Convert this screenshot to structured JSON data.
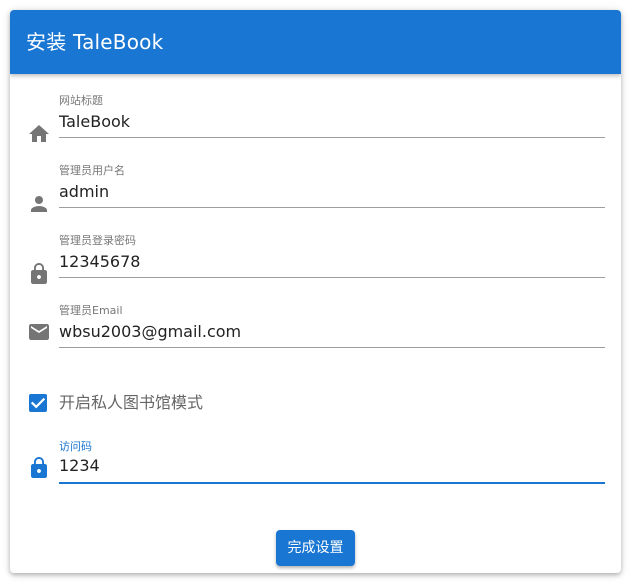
{
  "title": "安装 TaleBook",
  "fields": [
    {
      "label": "网站标题",
      "value": "TaleBook",
      "icon": "home-icon"
    },
    {
      "label": "管理员用户名",
      "value": "admin",
      "icon": "person-icon"
    },
    {
      "label": "管理员登录密码",
      "value": "12345678",
      "icon": "lock-icon"
    },
    {
      "label": "管理员Email",
      "value": "wbsu2003@gmail.com",
      "icon": "email-icon"
    }
  ],
  "private_mode": {
    "label": "开启私人图书馆模式",
    "checked": true,
    "icon": "checkbox-checked-icon"
  },
  "access_code": {
    "label": "访问码",
    "value": "1234",
    "icon": "lock-icon",
    "focused": true
  },
  "submit_label": "完成设置",
  "colors": {
    "primary": "#1976d2",
    "icon_gray": "#757575"
  }
}
